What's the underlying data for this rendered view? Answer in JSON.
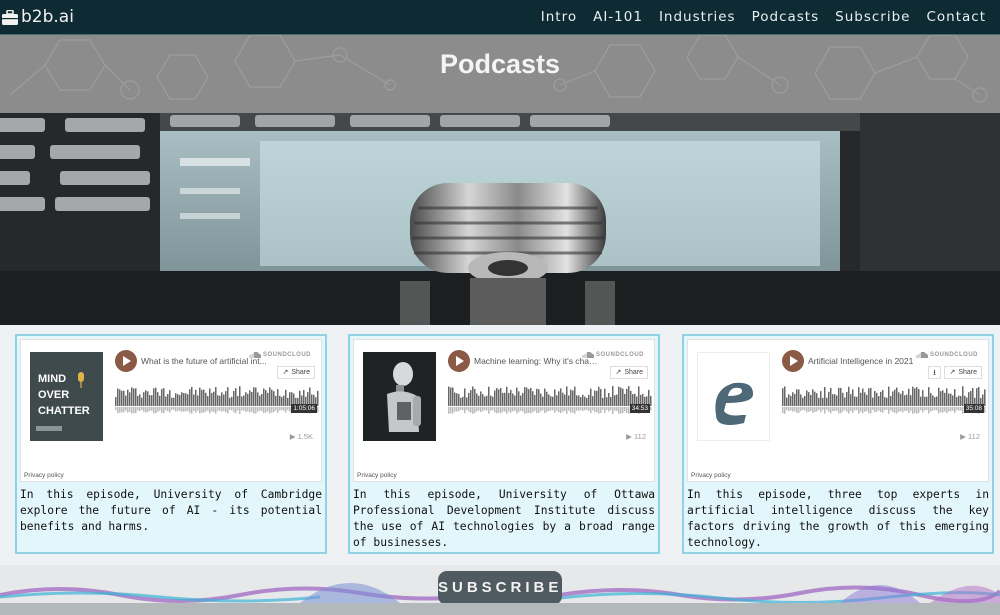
{
  "nav": {
    "brand": "b2b.ai",
    "brand_icon": "briefcase-icon",
    "items": [
      "Intro",
      "AI-101",
      "Industries",
      "Podcasts",
      "Subscribe",
      "Contact"
    ]
  },
  "page": {
    "title": "Podcasts"
  },
  "colors": {
    "nav_bg": "#0e2a33",
    "card_border": "#8fd2e4",
    "card_bg": "#e3f6fb",
    "play": "#8a5a46",
    "subscribe_bg": "#4f5b61"
  },
  "podcasts": [
    {
      "track_title": "What is the future of artificial int...",
      "soundcloud": "SOUNDCLOUD",
      "share": "Share",
      "duration": "1:05:06",
      "plays": "1.5K",
      "privacy": "Privacy policy",
      "artwork_text": [
        "MIND",
        "OVER",
        "CHATTER"
      ],
      "description": "In this episode, University of Cambridge explore the future of AI - its potential benefits and harms."
    },
    {
      "track_title": "Machine learning: Why it's chang...",
      "soundcloud": "SOUNDCLOUD",
      "share": "Share",
      "duration": "34:53",
      "plays": "112",
      "privacy": "Privacy policy",
      "artwork_text": [],
      "description": "In this episode, University of Ottawa Professional Development Institute discuss the use of AI technologies by a broad range of businesses."
    },
    {
      "track_title": "Artificial Intelligence in 2021",
      "soundcloud": "SOUNDCLOUD",
      "share": "Share",
      "duration": "35:08",
      "plays": "112",
      "privacy": "Privacy policy",
      "artwork_text": [],
      "description": "In this episode, three top experts in artificial intelligence discuss the key factors driving the growth of this emerging technology."
    }
  ],
  "subscribe": {
    "label": "SUBSCRIBE"
  }
}
